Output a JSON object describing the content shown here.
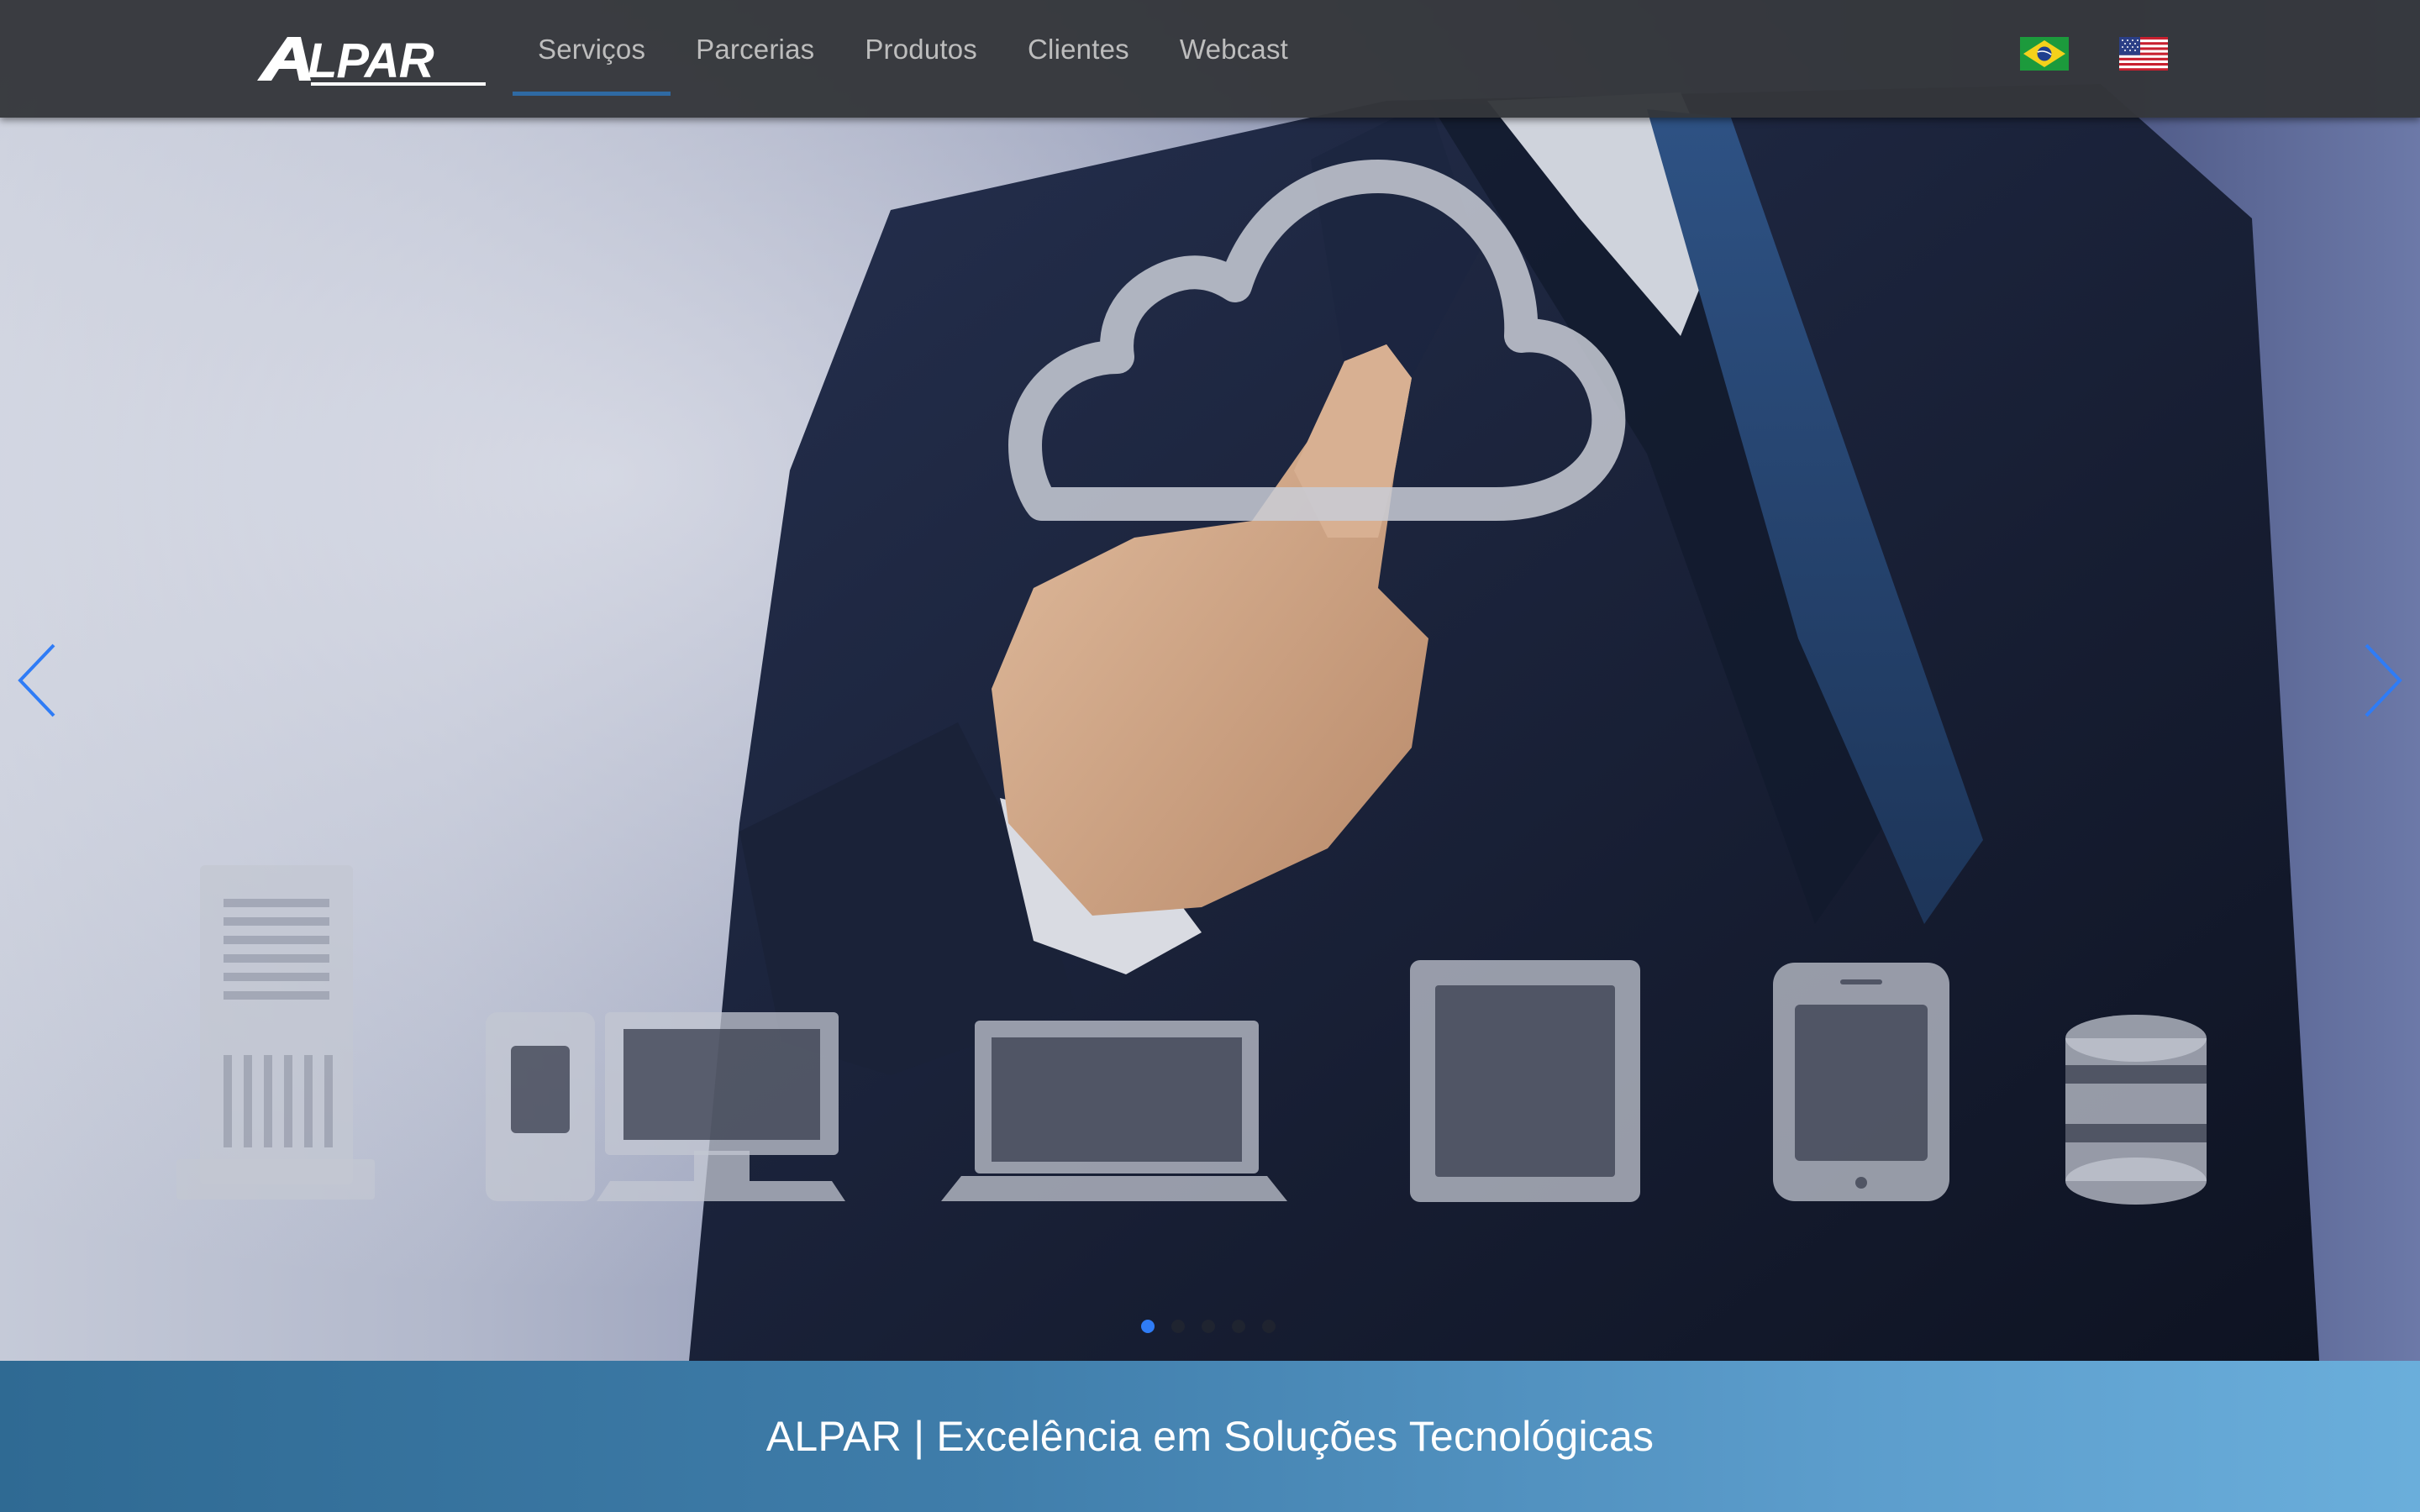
{
  "header": {
    "logo_text": "ALPAR",
    "nav": [
      {
        "label": "Serviços",
        "active": true
      },
      {
        "label": "Parcerias",
        "active": false
      },
      {
        "label": "Produtos",
        "active": false
      },
      {
        "label": "Clientes",
        "active": false
      },
      {
        "label": "Webcast",
        "active": false
      }
    ],
    "languages": [
      {
        "name": "flag-brazil-icon",
        "lang": "Português"
      },
      {
        "name": "flag-usa-icon",
        "lang": "English"
      }
    ]
  },
  "carousel": {
    "slide_count": 5,
    "active_slide": 1,
    "arrow_color": "#2f7cf6",
    "indicator_active_color": "#2f7cf6",
    "slide_icons": [
      "cloud-icon",
      "server-tower-icon",
      "desktop-computer-icon",
      "laptop-icon",
      "tablet-icon",
      "smartphone-icon",
      "database-icon"
    ]
  },
  "band": {
    "tagline": "ALPAR | Excelência em Soluções Tecnológicas"
  },
  "colors": {
    "header_bg": "#34363a",
    "nav_text": "#bdbdbd",
    "nav_active_underline": "#2f6aa3",
    "band_gradient_start": "#2f6a93",
    "band_gradient_end": "#6aaedb"
  }
}
